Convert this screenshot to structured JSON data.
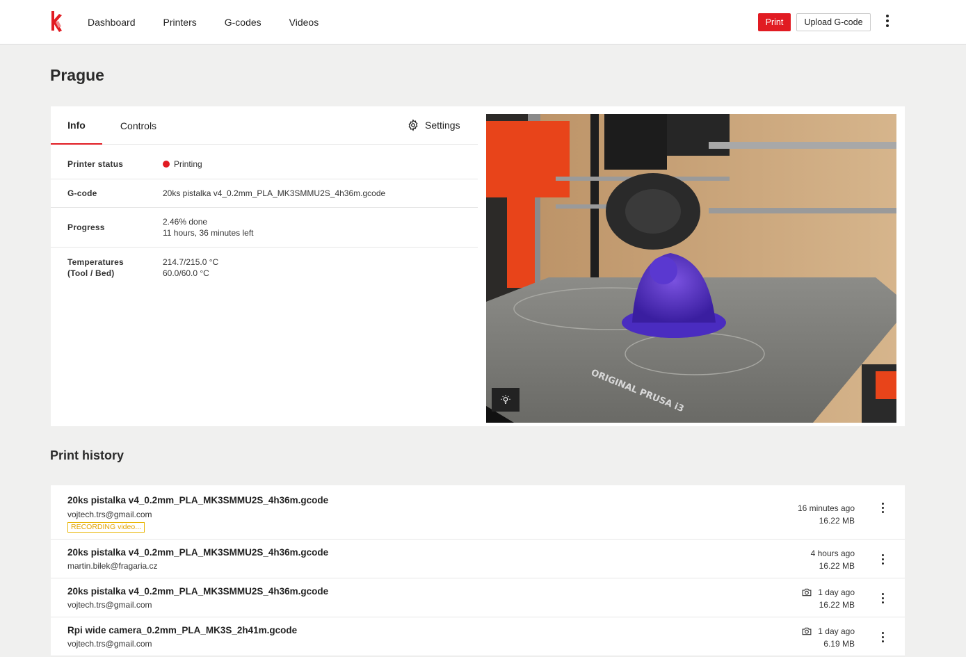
{
  "header": {
    "nav": [
      "Dashboard",
      "Printers",
      "G-codes",
      "Videos"
    ],
    "print_label": "Print",
    "upload_label": "Upload G-code"
  },
  "page": {
    "title": "Prague"
  },
  "tabs": {
    "info": "Info",
    "controls": "Controls",
    "settings": "Settings"
  },
  "info": {
    "status_label": "Printer status",
    "status_value": "Printing",
    "gcode_label": "G-code",
    "gcode_value": "20ks pistalka v4_0.2mm_PLA_MK3SMMU2S_4h36m.gcode",
    "progress_label": "Progress",
    "progress_done": "2.46% done",
    "progress_left": "11 hours, 36 minutes left",
    "temps_label_1": "Temperatures",
    "temps_label_2": "(Tool / Bed)",
    "temp_tool": "214.7/215.0 °C",
    "temp_bed": "60.0/60.0 °C"
  },
  "history": {
    "title": "Print history",
    "rows": [
      {
        "name": "20ks pistalka v4_0.2mm_PLA_MK3SMMU2S_4h36m.gcode",
        "email": "vojtech.trs@gmail.com",
        "badge": "RECORDING video...",
        "when": "16 minutes ago",
        "size": "16.22 MB"
      },
      {
        "name": "20ks pistalka v4_0.2mm_PLA_MK3SMMU2S_4h36m.gcode",
        "email": "martin.bilek@fragaria.cz",
        "when": "4 hours ago",
        "size": "16.22 MB"
      },
      {
        "name": "20ks pistalka v4_0.2mm_PLA_MK3SMMU2S_4h36m.gcode",
        "email": "vojtech.trs@gmail.com",
        "when": "1 day ago",
        "size": "16.22 MB"
      },
      {
        "name": "Rpi wide camera_0.2mm_PLA_MK3S_2h41m.gcode",
        "email": "vojtech.trs@gmail.com",
        "when": "1 day ago",
        "size": "6.19 MB"
      }
    ]
  },
  "colors": {
    "accent": "#e11b22",
    "badge": "#e8b400",
    "background": "#f0f0ef"
  }
}
